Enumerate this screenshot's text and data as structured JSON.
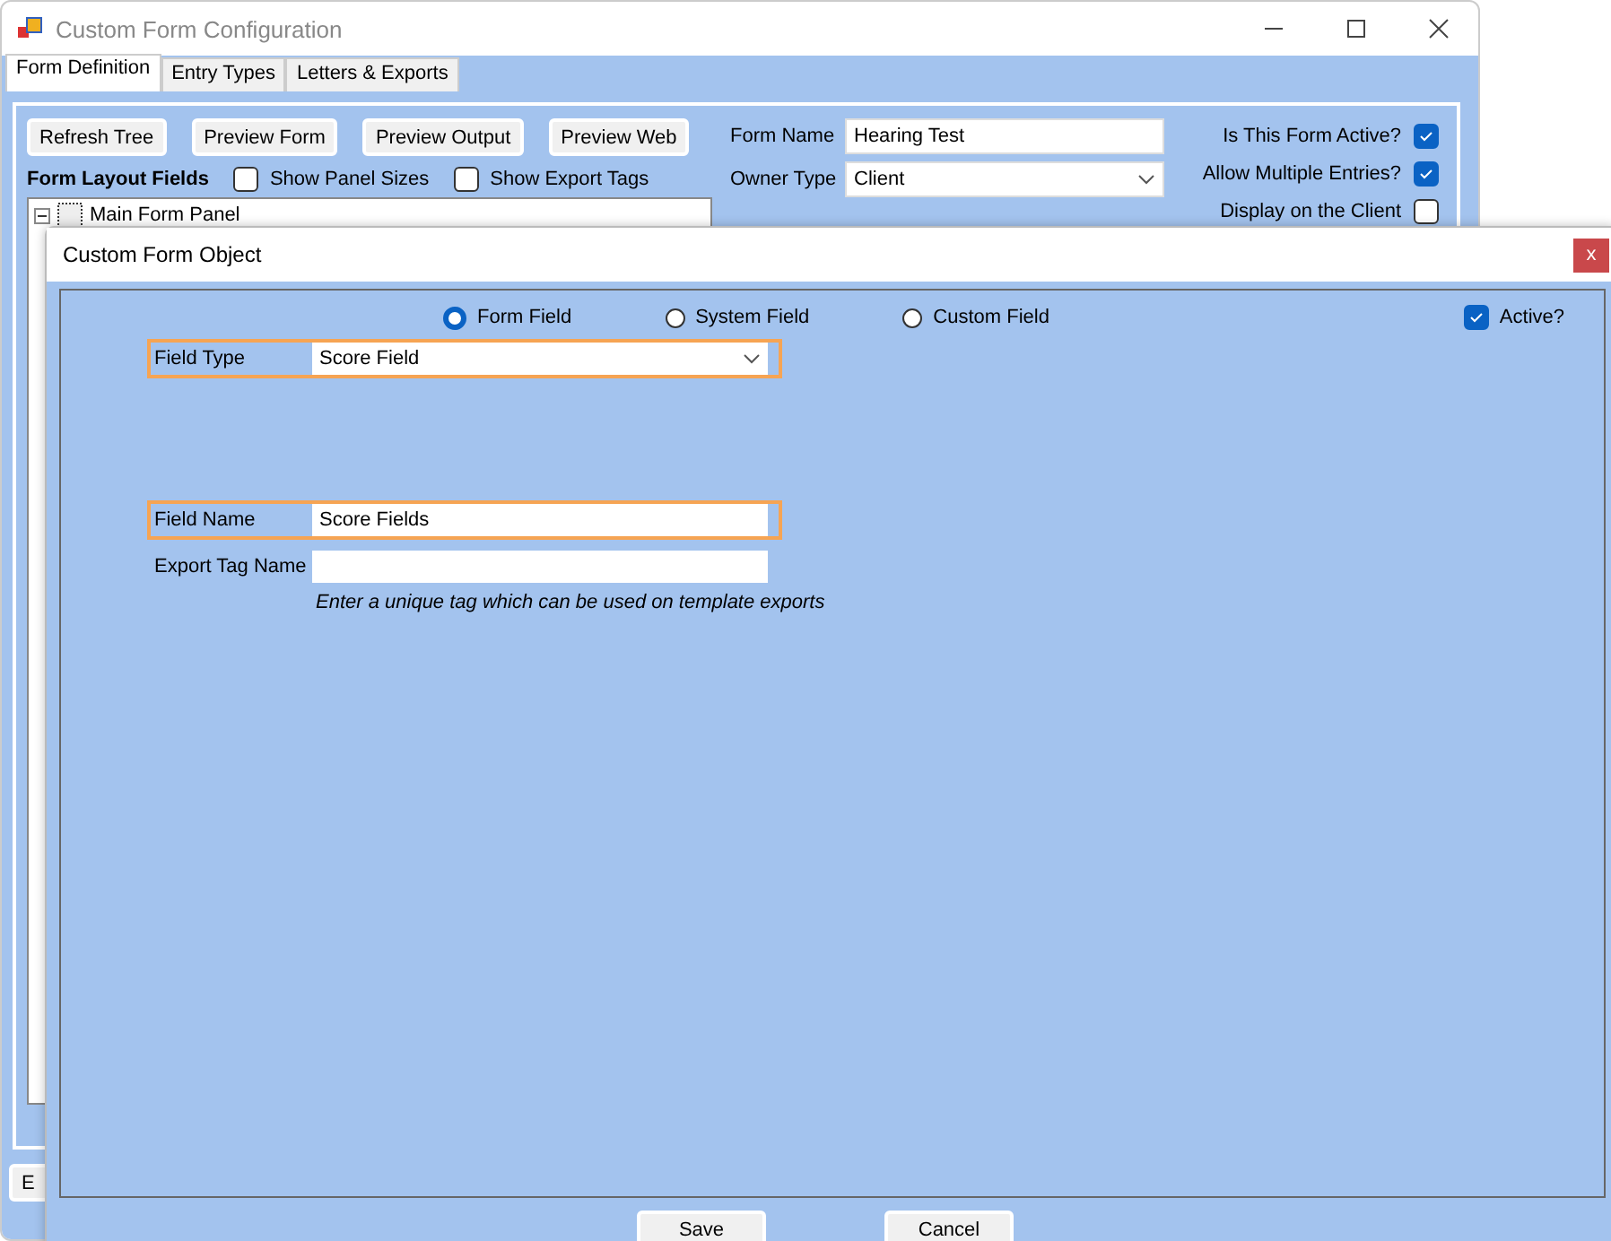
{
  "main_window": {
    "title": "Custom Form Configuration",
    "tabs": [
      {
        "label": "Form Definition",
        "selected": true
      },
      {
        "label": "Entry Types",
        "selected": false
      },
      {
        "label": "Letters & Exports",
        "selected": false
      }
    ],
    "toolbar_buttons": [
      "Refresh Tree",
      "Preview Form",
      "Preview Output",
      "Preview Web"
    ],
    "layout_heading": "Form Layout Fields",
    "layout_options": [
      {
        "label": "Show Panel Sizes",
        "checked": false
      },
      {
        "label": "Show Export Tags",
        "checked": false
      }
    ],
    "tree": [
      {
        "label": "Main Form Panel",
        "expanded": true
      }
    ],
    "form_name": {
      "label": "Form Name",
      "value": "Hearing Test"
    },
    "owner_type": {
      "label": "Owner Type",
      "value": "Client"
    },
    "flags": [
      {
        "label": "Is This Form Active?",
        "checked": true
      },
      {
        "label": "Allow Multiple Entries?",
        "checked": true
      },
      {
        "label": "Display on the Client",
        "checked": false
      }
    ],
    "bottom_button": "E"
  },
  "dialog": {
    "title": "Custom Form Object",
    "close": "x",
    "field_sources": [
      {
        "label": "Form Field",
        "selected": true
      },
      {
        "label": "System Field",
        "selected": false
      },
      {
        "label": "Custom Field",
        "selected": false
      }
    ],
    "active": {
      "label": "Active?",
      "checked": true
    },
    "field_type": {
      "label": "Field Type",
      "value": "Score Field",
      "highlighted": true
    },
    "field_name": {
      "label": "Field Name",
      "value": "Score Fields",
      "highlighted": true
    },
    "export_tag": {
      "label": "Export Tag Name",
      "hint": "Enter a unique tag which can be used on template exports",
      "highlighted": false
    },
    "buttons": [
      "Save",
      "Cancel"
    ]
  }
}
